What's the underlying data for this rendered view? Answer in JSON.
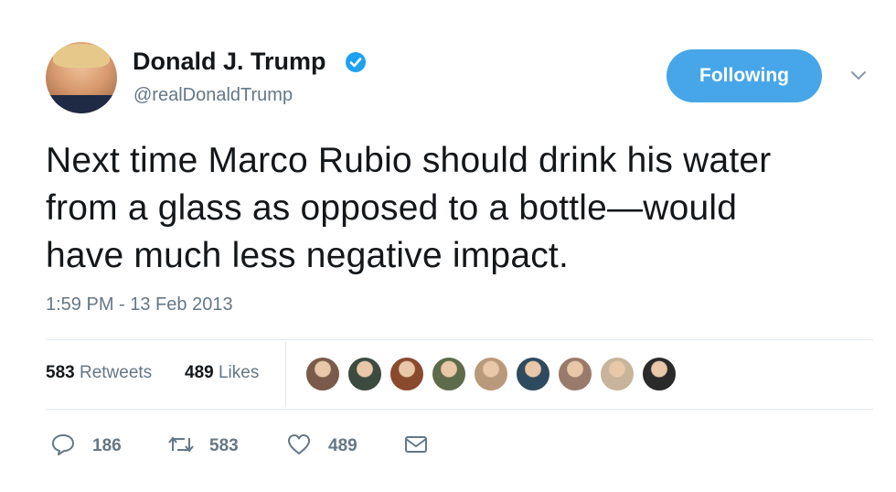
{
  "author": {
    "name": "Donald J. Trump",
    "handle": "@realDonaldTrump",
    "verified": true
  },
  "follow_button": {
    "label": "Following",
    "color": "#47a6e8"
  },
  "tweet": {
    "lines": [
      "Next time Marco Rubio should drink his water",
      "from a glass as opposed to a bottle—would",
      "have much less negative impact."
    ],
    "timestamp": "1:59 PM - 13 Feb 2013"
  },
  "stats": {
    "retweets_count": "583",
    "retweets_label": "Retweets",
    "likes_count": "489",
    "likes_label": "Likes"
  },
  "likers": [
    {
      "name": "liker-1-avatar",
      "color": "#7a5a4a"
    },
    {
      "name": "liker-2-avatar",
      "color": "#3d4a3f"
    },
    {
      "name": "liker-3-avatar",
      "color": "#8a4a2e"
    },
    {
      "name": "liker-4-avatar",
      "color": "#5e6b4a"
    },
    {
      "name": "liker-5-avatar",
      "color": "#b89a7a"
    },
    {
      "name": "liker-6-avatar",
      "color": "#2e4a5e"
    },
    {
      "name": "liker-7-avatar",
      "color": "#9a7a6a"
    },
    {
      "name": "liker-8-avatar",
      "color": "#c7b49a"
    },
    {
      "name": "liker-9-avatar",
      "color": "#2a2a2a"
    }
  ],
  "actions": {
    "reply_count": "186",
    "retweet_count": "583",
    "like_count": "489"
  },
  "colors": {
    "text": "#14171a",
    "secondary": "#657786",
    "accent": "#1da1f2",
    "divider": "#e1e8ed"
  }
}
